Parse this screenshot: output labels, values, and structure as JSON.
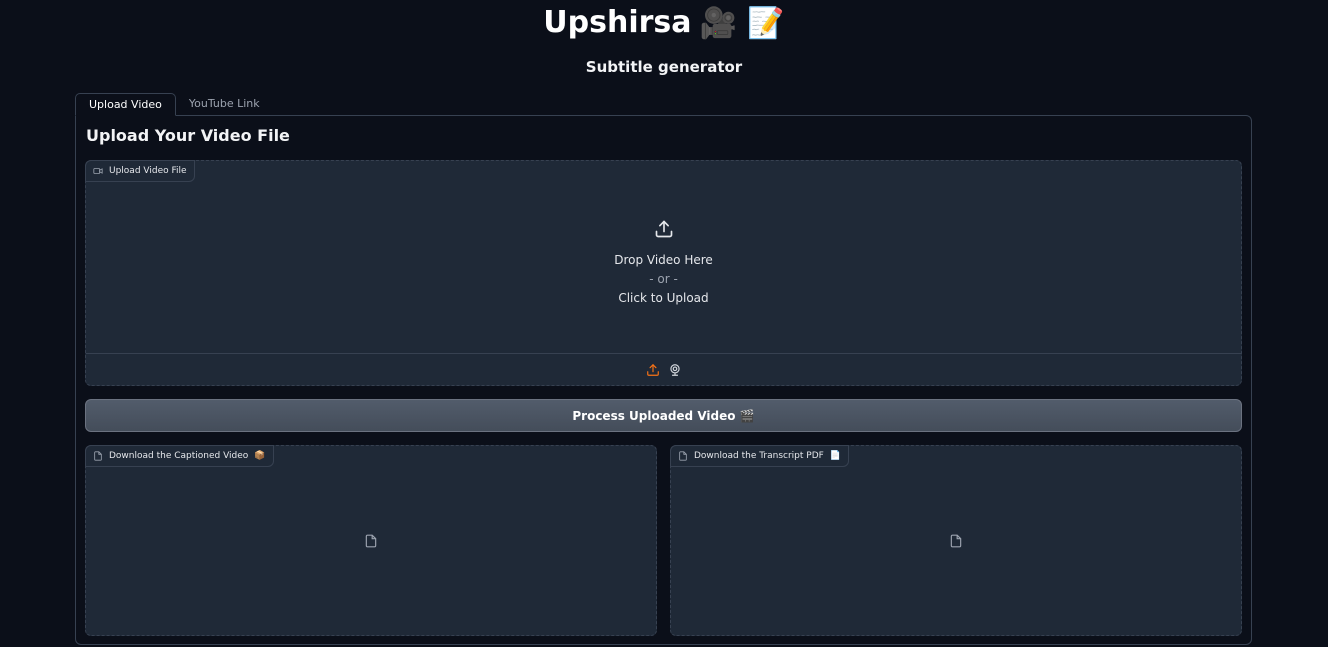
{
  "header": {
    "title": "Upshirsa",
    "title_emoji": "🎥 📝",
    "subtitle": "Subtitle generator"
  },
  "tabs": [
    {
      "label": "Upload Video",
      "active": true
    },
    {
      "label": "YouTube Link",
      "active": false
    }
  ],
  "upload_panel": {
    "heading": "Upload Your Video File",
    "video_input": {
      "label": "Upload Video File",
      "drop_text": "Drop Video Here",
      "or_text": "- or -",
      "click_text": "Click to Upload",
      "source_icons": [
        "upload-icon",
        "webcam-icon"
      ]
    },
    "process_button": {
      "label": "Process Uploaded Video",
      "emoji": "🎬"
    },
    "outputs": [
      {
        "label": "Download the Captioned Video",
        "emoji": "📦"
      },
      {
        "label": "Download the Transcript PDF",
        "emoji": "📄"
      }
    ]
  },
  "colors": {
    "background": "#0b0f19",
    "block": "#1f2937",
    "border": "#374151",
    "accent": "#f97316"
  }
}
